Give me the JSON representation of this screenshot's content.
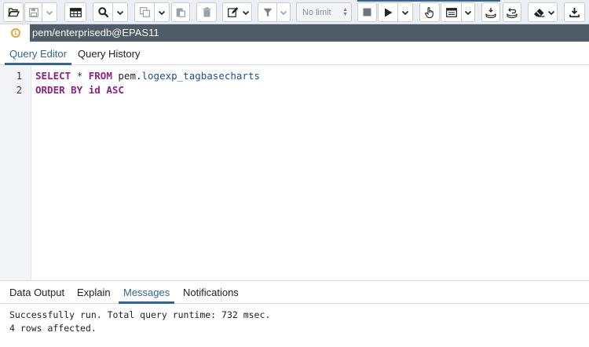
{
  "toolbar": {
    "limit_label": "No limit",
    "buttons": [
      {
        "name": "open-file",
        "icon": "folder-open-icon"
      },
      {
        "name": "save-file",
        "icon": "save-icon"
      },
      {
        "name": "save-options",
        "icon": "chevron-down-icon"
      },
      {
        "name": "edit-data",
        "icon": "table-grid-icon"
      },
      {
        "name": "find",
        "icon": "search-icon"
      },
      {
        "name": "copy",
        "icon": "copy-icon"
      },
      {
        "name": "paste",
        "icon": "paste-icon"
      },
      {
        "name": "delete",
        "icon": "trash-icon"
      },
      {
        "name": "edit",
        "icon": "pencil-square-icon"
      },
      {
        "name": "filter",
        "icon": "filter-icon"
      },
      {
        "name": "stop",
        "icon": "stop-icon"
      },
      {
        "name": "execute",
        "icon": "play-icon"
      },
      {
        "name": "explain",
        "icon": "hand-pointer-icon"
      },
      {
        "name": "explain-analyze",
        "icon": "window-icon"
      },
      {
        "name": "commit",
        "icon": "database-commit-icon"
      },
      {
        "name": "rollback",
        "icon": "database-rollback-icon"
      },
      {
        "name": "clear",
        "icon": "eraser-icon"
      },
      {
        "name": "download",
        "icon": "download-icon"
      }
    ]
  },
  "connection": {
    "status_icon": "connection-status-icon",
    "label": "pem/enterprisedb@EPAS11",
    "status_color": "#e8a33a",
    "bar_color": "#4d5c66"
  },
  "editor_tabs": [
    {
      "label": "Query Editor",
      "active": true
    },
    {
      "label": "Query History",
      "active": false
    }
  ],
  "editor": {
    "line_numbers": [
      "1",
      "2"
    ],
    "lines": [
      {
        "kw1": "SELECT",
        "op": "*",
        "kw2": "FROM",
        "schema": "pem.",
        "table": "logexp_tagbasecharts"
      },
      {
        "kw": "ORDER BY",
        "rest": "id",
        "kw_end": "ASC"
      }
    ]
  },
  "result_tabs": [
    {
      "label": "Data Output",
      "active": false
    },
    {
      "label": "Explain",
      "active": false
    },
    {
      "label": "Messages",
      "active": true
    },
    {
      "label": "Notifications",
      "active": false
    }
  ],
  "messages": [
    "Successfully run. Total query runtime: 732 msec.",
    "4 rows affected."
  ],
  "colors": {
    "accent": "#326690",
    "keyword": "#8f1f84",
    "identifier": "#1d4f8f"
  }
}
